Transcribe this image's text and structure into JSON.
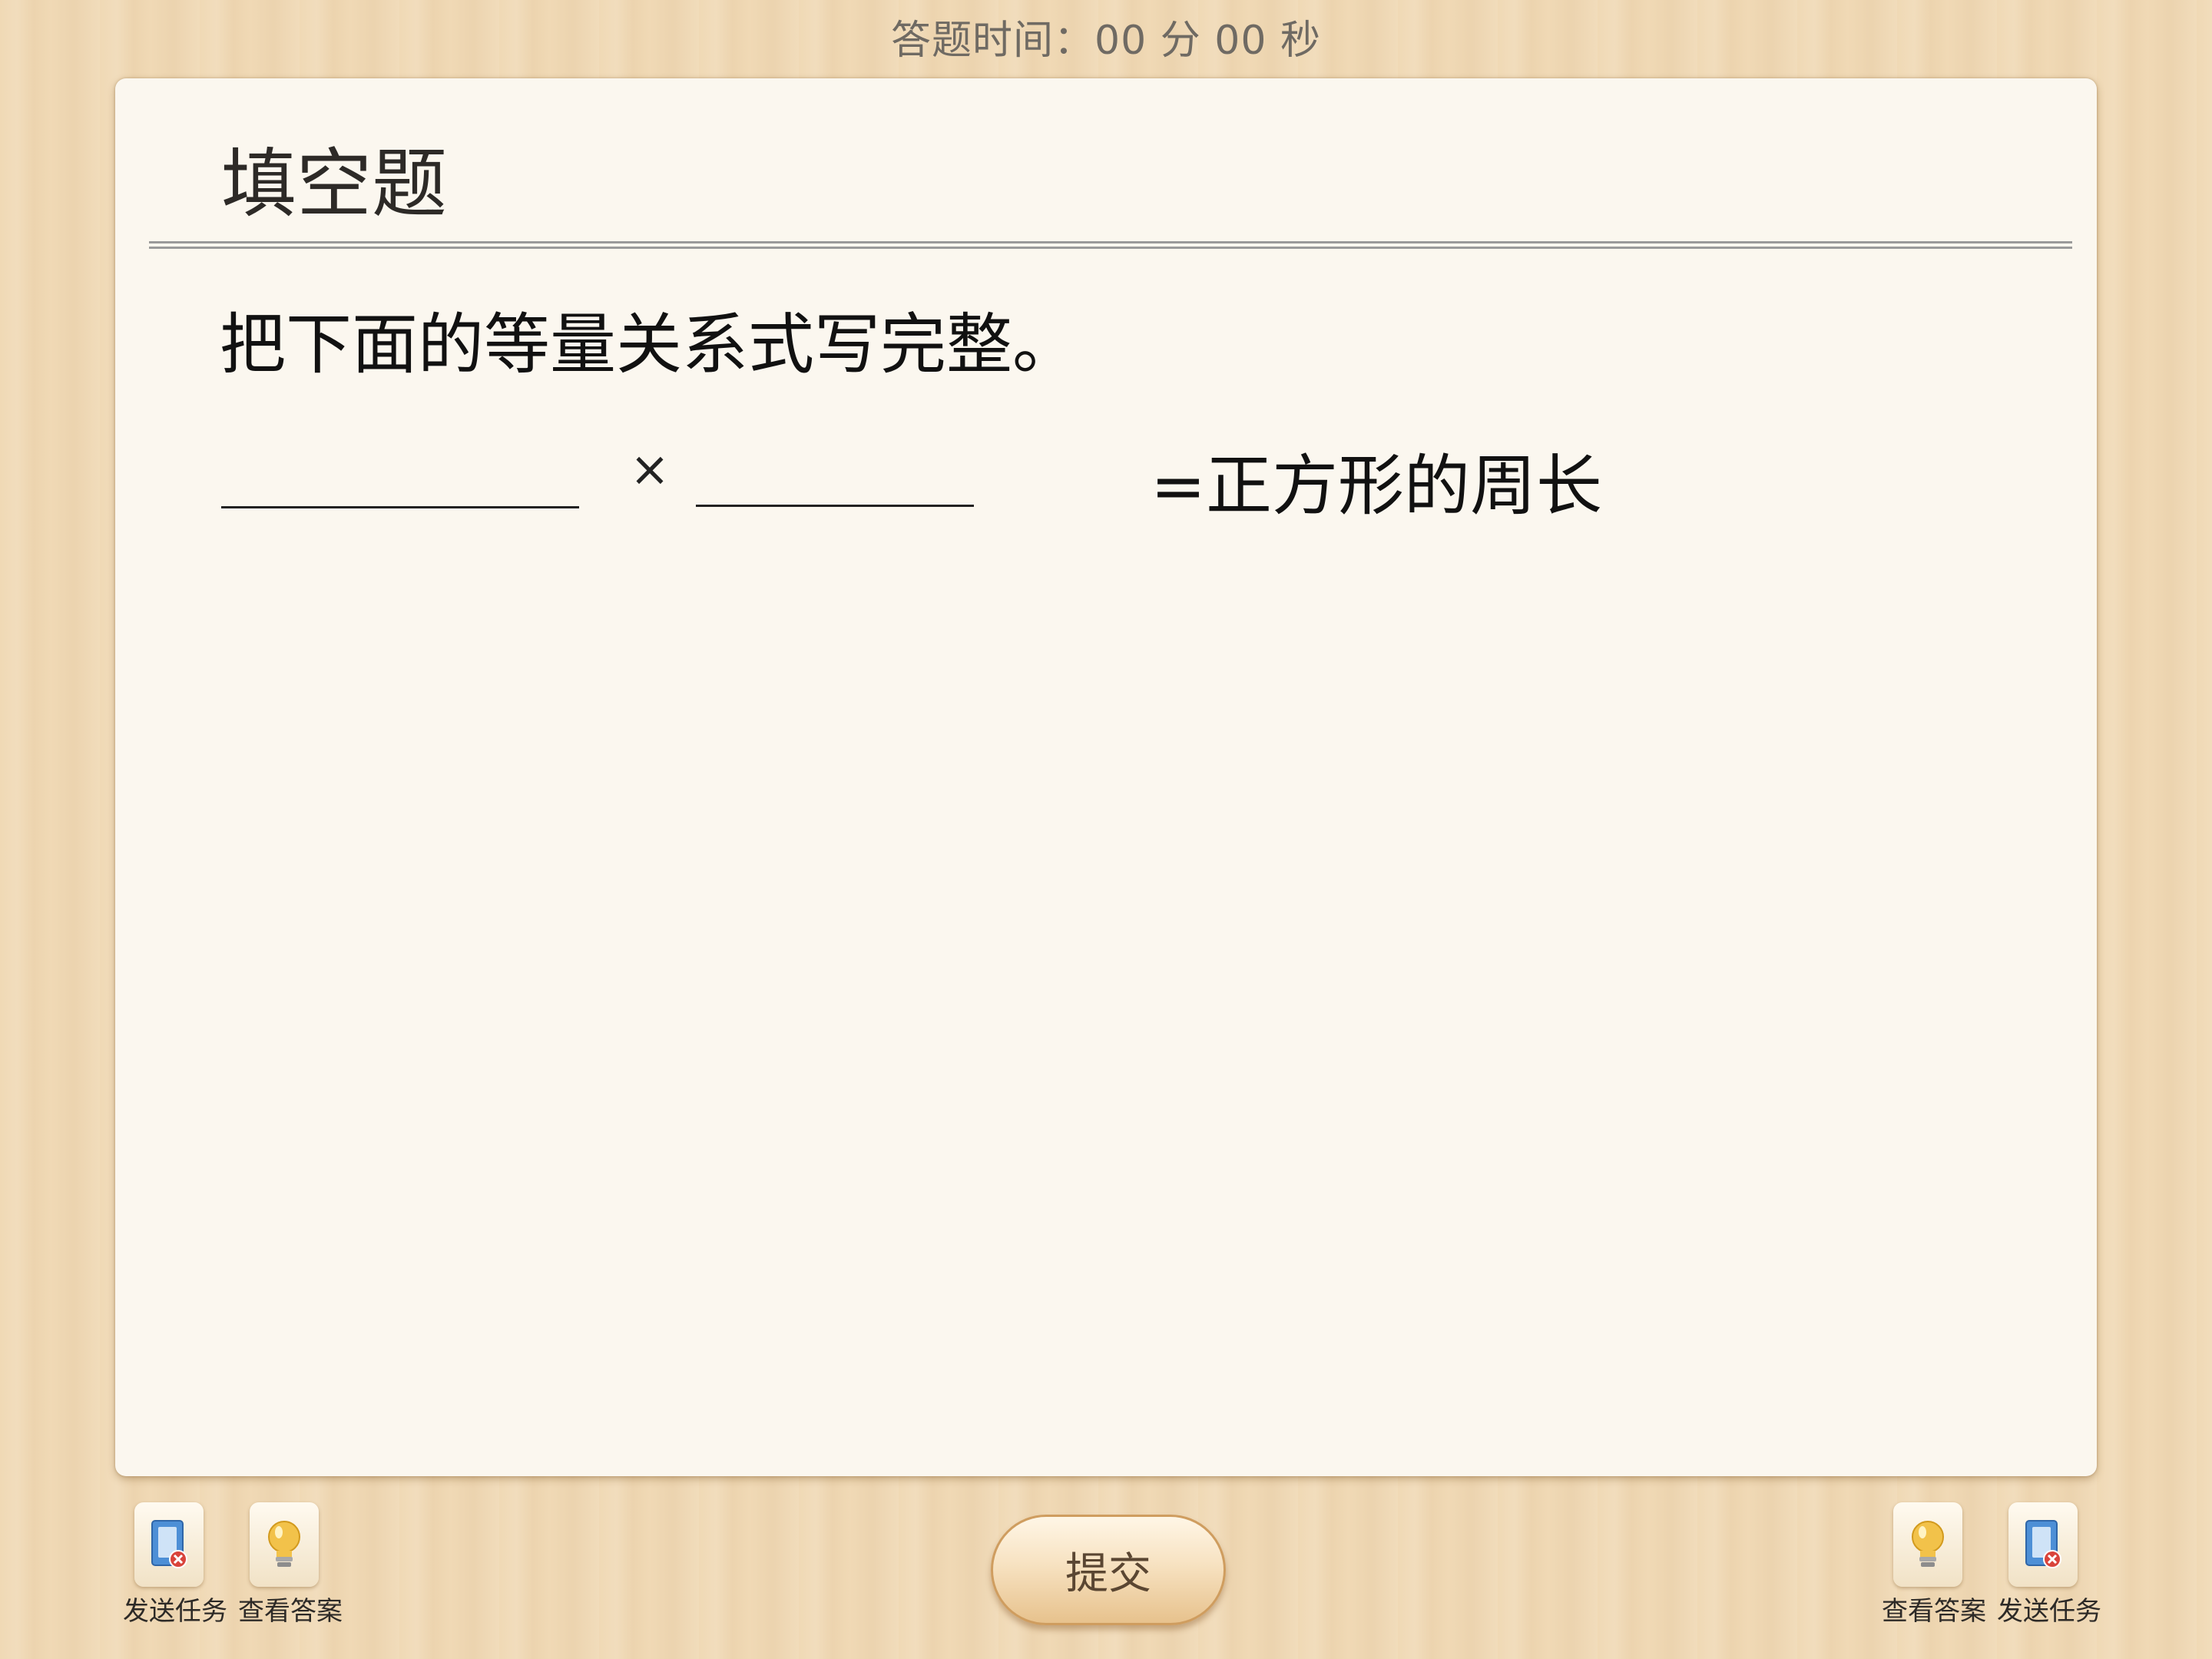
{
  "timer": {
    "label": "答题时间：00 分 00 秒"
  },
  "question": {
    "type_title": "填空题",
    "instruction": "把下面的等量关系式写完整。",
    "operator": "×",
    "result_text": "=正方形的周长",
    "blank_1_value": "",
    "blank_2_value": ""
  },
  "toolbar": {
    "left": [
      {
        "label": "发送任务",
        "icon": "send-task-icon"
      },
      {
        "label": "查看答案",
        "icon": "lightbulb-icon"
      }
    ],
    "right": [
      {
        "label": "查看答案",
        "icon": "lightbulb-icon"
      },
      {
        "label": "发送任务",
        "icon": "send-task-icon"
      }
    ],
    "submit_label": "提交"
  },
  "colors": {
    "background_wood": "#f0d9b5",
    "card": "#fbf7ef",
    "accent_bulb": "#f2c24a",
    "accent_task_blue": "#4d8fd6",
    "accent_task_red": "#d9443b"
  }
}
